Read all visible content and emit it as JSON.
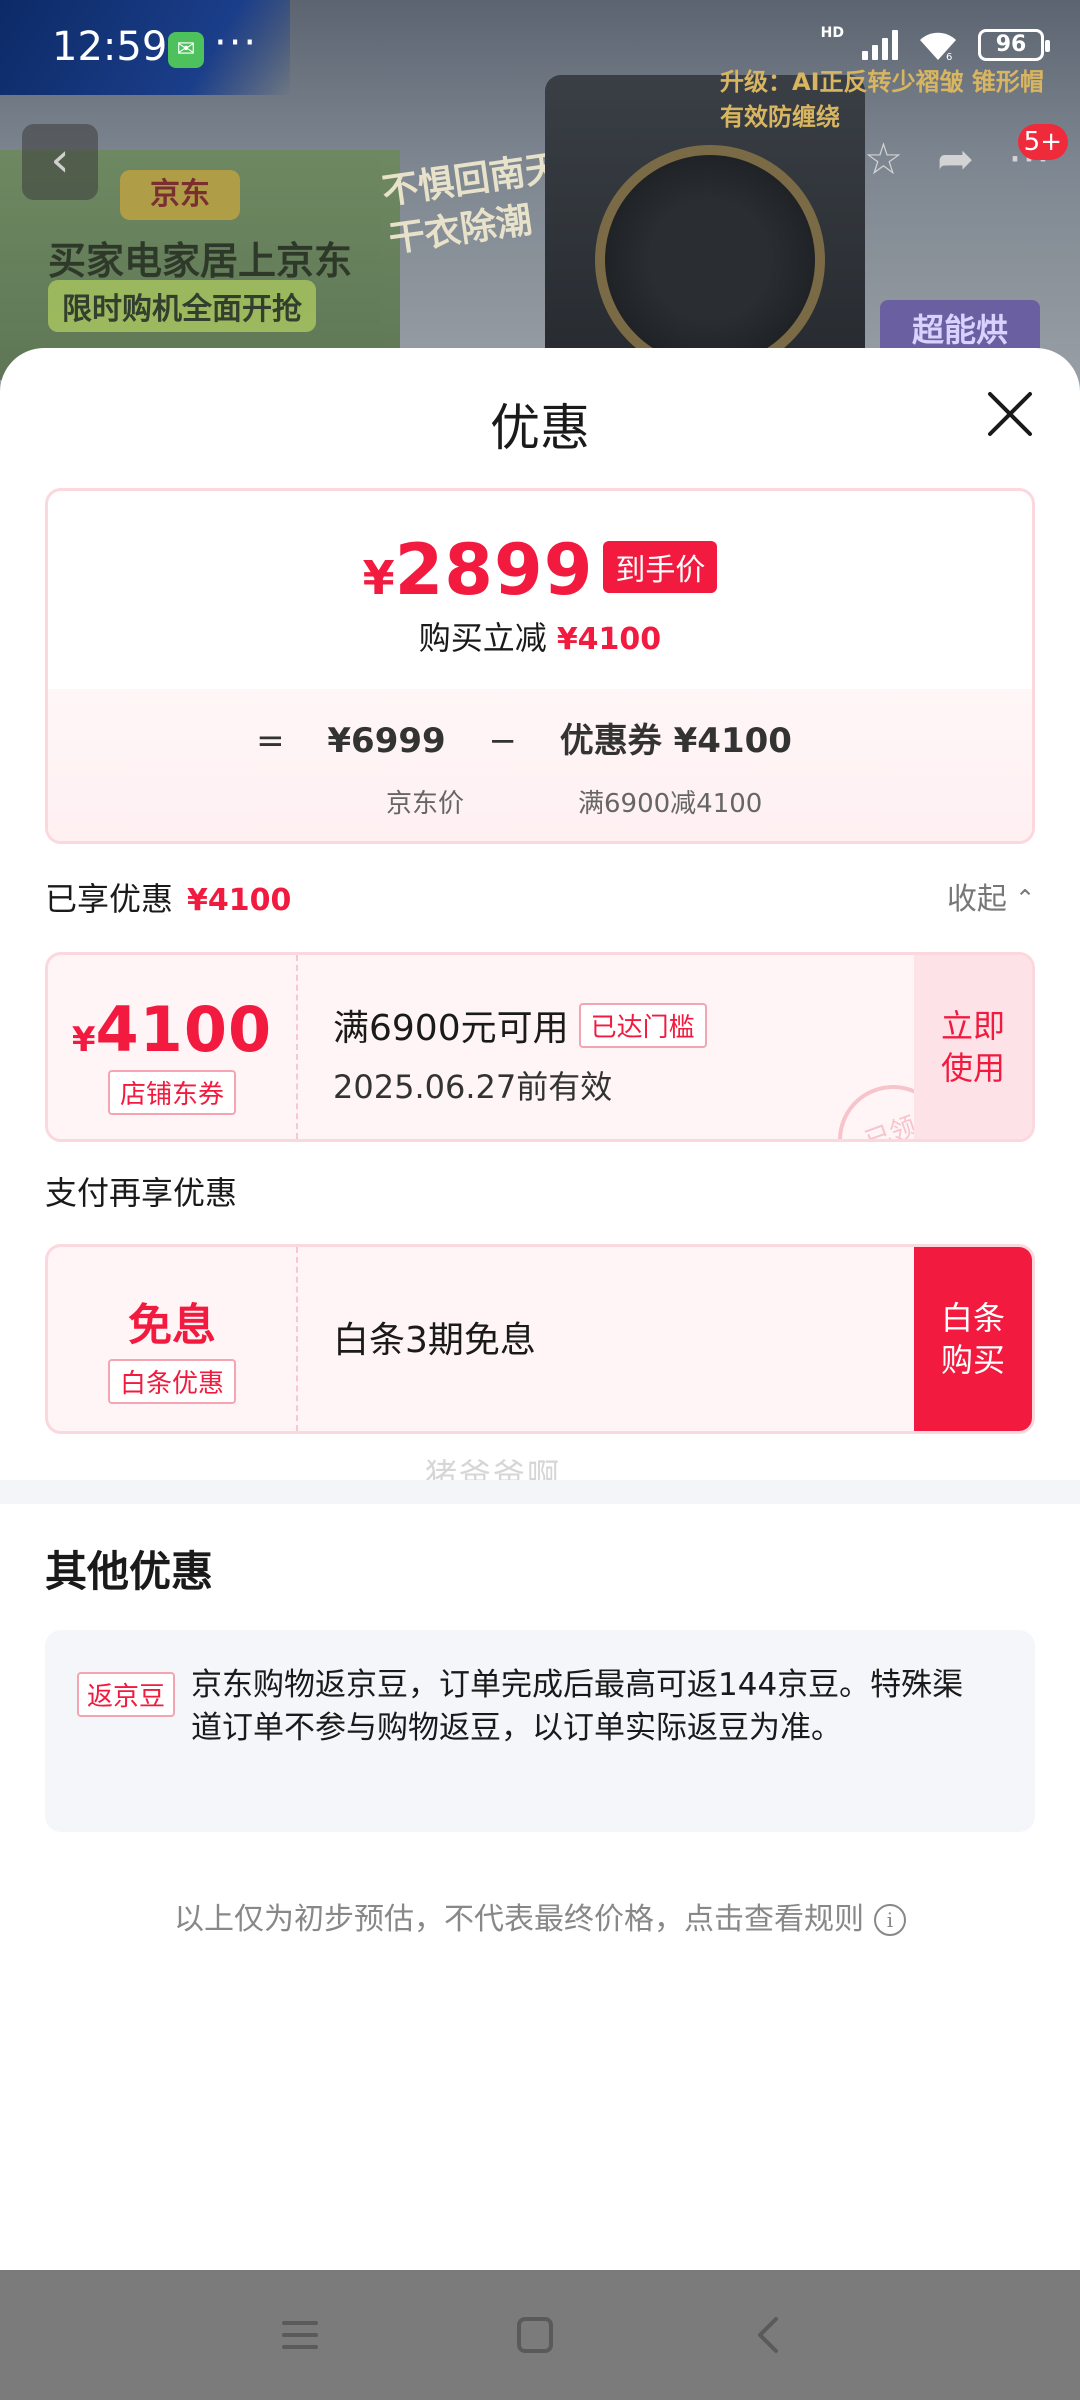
{
  "status_bar": {
    "time": "12:59",
    "wechat_icon": "wechat-icon",
    "overflow": "···",
    "hd": "HD",
    "battery": "96"
  },
  "background": {
    "promo_brand": "京东",
    "promo_line1": "买家电家居上京东",
    "promo_line2": "限时购机全面开抢",
    "slogan": "不惧回南天干衣除潮",
    "feature_text": "升级：AI正反转少褶皱 锥形帽有效防缠绕",
    "feature_badge": "超能烘",
    "notification_count": "5+"
  },
  "sheet": {
    "title": "优惠",
    "summary": {
      "currency": "¥",
      "final_price": "2899",
      "final_tag": "到手价",
      "instant_label": "购买立减",
      "instant_amount": "¥4100",
      "eq": "=",
      "jd_price": "¥6999",
      "minus": "−",
      "coupon_label": "优惠券 ¥4100",
      "jd_price_label": "京东价",
      "coupon_rule": "满6900减4100"
    },
    "enjoyed": {
      "label": "已享优惠",
      "amount": "¥4100",
      "collapse_label": "收起"
    },
    "coupon": {
      "currency": "¥",
      "amount": "4100",
      "type": "店铺东券",
      "condition": "满6900元可用",
      "reached": "已达门槛",
      "validity": "2025.06.27前有效",
      "action": "立即使用",
      "stamp": "已领"
    },
    "watermark": "猪爸爸啊",
    "pay": {
      "label": "支付再享优惠",
      "title": "免息",
      "type": "白条优惠",
      "desc": "白条3期免息",
      "action": "白条购买"
    },
    "other": {
      "title": "其他优惠",
      "tag": "返京豆",
      "text": "京东购物返京豆，订单完成后最高可返144京豆。特殊渠道订单不参与购物返豆，以订单实际返豆为准。"
    },
    "disclaimer": "以上仅为初步预估，不代表最终价格，点击查看规则",
    "info_icon": "i"
  },
  "colors": {
    "accent": "#f21b3f",
    "card_border": "#fbd8de",
    "card_bg": "#fff5f6"
  }
}
